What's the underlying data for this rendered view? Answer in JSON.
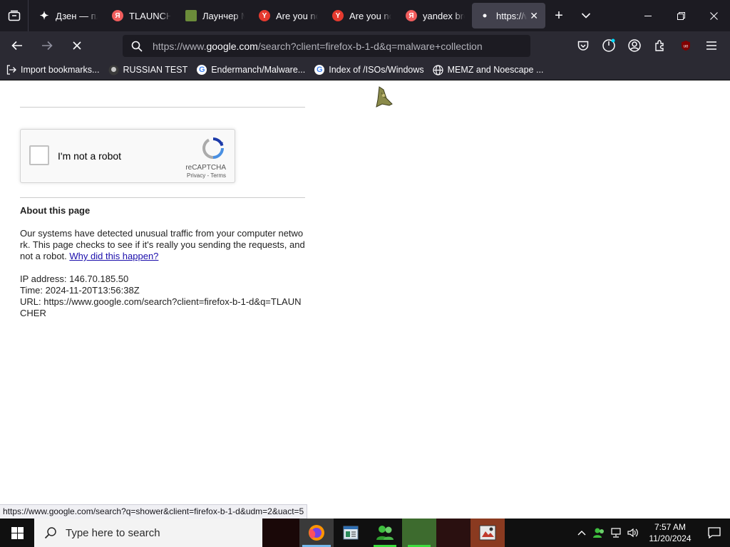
{
  "tabs": [
    {
      "label": "Дзен — пл",
      "icon": "sparkle-icon"
    },
    {
      "label": "TLAUNCHE",
      "icon": "yandex-icon"
    },
    {
      "label": "Лаунчер М",
      "icon": "minecraft-icon"
    },
    {
      "label": "Are you no",
      "icon": "yandex-browser-icon"
    },
    {
      "label": "Are you no",
      "icon": "yandex-browser-icon"
    },
    {
      "label": "yandex bro",
      "icon": "yandex-icon"
    },
    {
      "label": "https://w",
      "icon": "loading-dot-icon",
      "active": true
    }
  ],
  "nav": {
    "url_prefix": "https://www.",
    "url_domain": "google.com",
    "url_suffix": "/search?client=firefox-b-1-d&q=malware+collection"
  },
  "bookmarks": [
    {
      "label": "Import bookmarks...",
      "icon": "import-icon"
    },
    {
      "label": "RUSSIAN TEST",
      "icon": "github-icon"
    },
    {
      "label": "Endermanch/Malware...",
      "icon": "google-icon"
    },
    {
      "label": "Index of /ISOs/Windows",
      "icon": "google-icon"
    },
    {
      "label": "MEMZ and Noescape ...",
      "icon": "globe-icon"
    }
  ],
  "captcha": {
    "label": "I'm not a robot",
    "brand": "reCAPTCHA",
    "privacy": "Privacy",
    "separator": " - ",
    "terms": "Terms"
  },
  "about": {
    "title": "About this page",
    "text": "Our systems have detected unusual traffic from your computer network. This page checks to see if it's really you sending the requests, and not a robot. ",
    "link": "Why did this happen?",
    "ip": "IP address: 146.70.185.50",
    "time": "Time: 2024-11-20T13:56:38Z",
    "url": "URL: https://www.google.com/search?client=firefox-b-1-d&q=TLAUNCHER"
  },
  "status_link": "https://www.google.com/search?q=shower&client=firefox-b-1-d&udm=2&uact=5",
  "taskbar": {
    "search_placeholder": "Type here to search",
    "time": "7:57 AM",
    "date": "11/20/2024"
  }
}
